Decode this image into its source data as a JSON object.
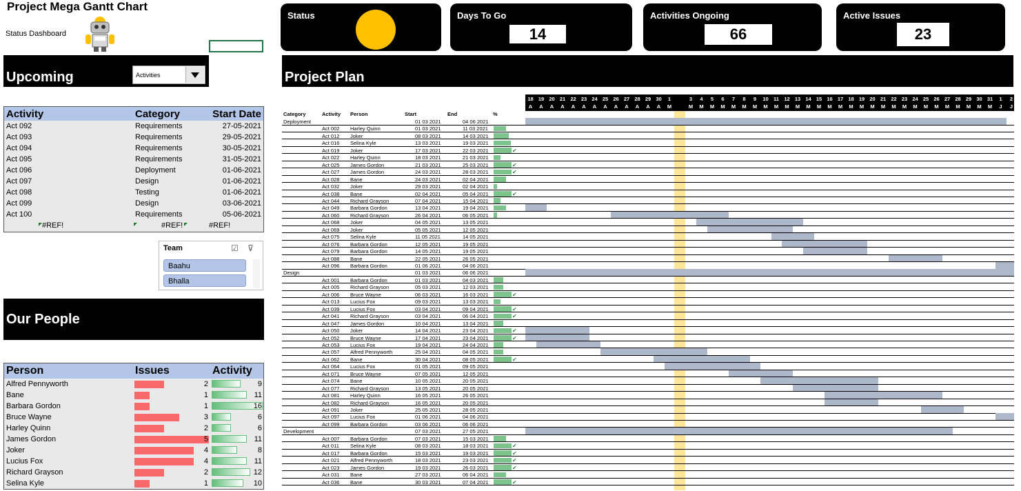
{
  "title": "Project Mega Gantt Chart",
  "subtitle": "Status Dashboard",
  "upcoming": {
    "heading": "Upcoming",
    "dropdown": "Activities",
    "columns": [
      "Activity",
      "Category",
      "Start Date"
    ],
    "rows": [
      [
        "Act 092",
        "Requirements",
        "27-05-2021"
      ],
      [
        "Act 093",
        "Requirements",
        "29-05-2021"
      ],
      [
        "Act 094",
        "Requirements",
        "30-05-2021"
      ],
      [
        "Act 095",
        "Requirements",
        "31-05-2021"
      ],
      [
        "Act 096",
        "Deployment",
        "01-06-2021"
      ],
      [
        "Act 097",
        "Design",
        "01-06-2021"
      ],
      [
        "Act 098",
        "Testing",
        "01-06-2021"
      ],
      [
        "Act 099",
        "Design",
        "03-06-2021"
      ],
      [
        "Act 100",
        "Requirements",
        "05-06-2021"
      ],
      [
        "#REF!",
        "#REF!",
        "#REF!"
      ]
    ]
  },
  "slicer": {
    "title": "Team",
    "items": [
      "Baahu",
      "Bhalla"
    ]
  },
  "people": {
    "heading": "Our People",
    "columns": [
      "Person",
      "Issues",
      "Activity"
    ],
    "rows": [
      {
        "name": "Alfred Pennyworth",
        "issues": 2,
        "activity": 9
      },
      {
        "name": "Bane",
        "issues": 1,
        "activity": 11
      },
      {
        "name": "Barbara Gordon",
        "issues": 1,
        "activity": 16
      },
      {
        "name": "Bruce Wayne",
        "issues": 3,
        "activity": 6
      },
      {
        "name": "Harley Quinn",
        "issues": 2,
        "activity": 6
      },
      {
        "name": "James Gordon",
        "issues": 5,
        "activity": 11
      },
      {
        "name": "Joker",
        "issues": 4,
        "activity": 8
      },
      {
        "name": "Lucius Fox",
        "issues": 4,
        "activity": 11
      },
      {
        "name": "Richard Grayson",
        "issues": 2,
        "activity": 12
      },
      {
        "name": "Selina Kyle",
        "issues": 1,
        "activity": 10
      }
    ]
  },
  "cards": {
    "status": {
      "label": "Status",
      "color": "#ffc000"
    },
    "days": {
      "label": "Days To Go",
      "value": "14"
    },
    "ongoing": {
      "label": "Activities Ongoing",
      "value": "66"
    },
    "issues": {
      "label": "Active Issues",
      "value": "23"
    }
  },
  "plan": {
    "heading": "Project Plan",
    "col_headers": [
      "Category",
      "Activity",
      "Person",
      "Start",
      "End",
      "%"
    ],
    "days": [
      "18",
      "19",
      "20",
      "21",
      "22",
      "23",
      "24",
      "25",
      "26",
      "27",
      "28",
      "29",
      "30",
      "1",
      "",
      "3",
      "4",
      "5",
      "6",
      "7",
      "8",
      "9",
      "10",
      "11",
      "12",
      "13",
      "14",
      "15",
      "16",
      "17",
      "18",
      "19",
      "20",
      "21",
      "22",
      "23",
      "24",
      "25",
      "26",
      "27",
      "28",
      "29",
      "30",
      "31",
      "1",
      "2"
    ],
    "months": [
      "A",
      "A",
      "A",
      "A",
      "A",
      "A",
      "A",
      "A",
      "A",
      "A",
      "A",
      "A",
      "A",
      "M",
      "",
      "M",
      "M",
      "M",
      "M",
      "M",
      "M",
      "M",
      "M",
      "M",
      "M",
      "M",
      "M",
      "M",
      "M",
      "M",
      "M",
      "M",
      "M",
      "M",
      "M",
      "M",
      "M",
      "M",
      "M",
      "M",
      "M",
      "M",
      "M",
      "M",
      "J",
      "J"
    ],
    "rows": [
      {
        "c": "Deployment",
        "a": "",
        "p": "",
        "s": "01 03 2021",
        "e": "04 06 2021",
        "pct": 0,
        "chk": false,
        "bar": [
          0,
          45
        ]
      },
      {
        "c": "",
        "a": "Act 002",
        "p": "Harley Quinn",
        "s": "01 03 2021",
        "e": "11 03 2021",
        "pct": 0.7,
        "chk": false,
        "bar": null
      },
      {
        "c": "",
        "a": "Act 012",
        "p": "Joker",
        "s": "08 03 2021",
        "e": "14 03 2021",
        "pct": 0.85,
        "chk": false,
        "bar": null
      },
      {
        "c": "",
        "a": "Act 016",
        "p": "Selina Kyle",
        "s": "13 03 2021",
        "e": "19 03 2021",
        "pct": 0.95,
        "chk": false,
        "bar": null
      },
      {
        "c": "",
        "a": "Act 019",
        "p": "Joker",
        "s": "17 03 2021",
        "e": "22 03 2021",
        "pct": 1,
        "chk": true,
        "bar": null
      },
      {
        "c": "",
        "a": "Act 022",
        "p": "Harley Quinn",
        "s": "18 03 2021",
        "e": "21 03 2021",
        "pct": 0.4,
        "chk": false,
        "bar": null
      },
      {
        "c": "",
        "a": "Act 025",
        "p": "James Gordon",
        "s": "21 03 2021",
        "e": "25 03 2021",
        "pct": 1,
        "chk": true,
        "bar": null
      },
      {
        "c": "",
        "a": "Act 027",
        "p": "James Gordon",
        "s": "24 03 2021",
        "e": "28 03 2021",
        "pct": 1,
        "chk": true,
        "bar": null
      },
      {
        "c": "",
        "a": "Act 028",
        "p": "Bane",
        "s": "24 03 2021",
        "e": "02 04 2021",
        "pct": 0.7,
        "chk": false,
        "bar": null
      },
      {
        "c": "",
        "a": "Act 032",
        "p": "Joker",
        "s": "29 03 2021",
        "e": "02 04 2021",
        "pct": 0.2,
        "chk": false,
        "bar": null
      },
      {
        "c": "",
        "a": "Act 038",
        "p": "Bane",
        "s": "02 04 2021",
        "e": "05 04 2021",
        "pct": 1,
        "chk": true,
        "bar": null
      },
      {
        "c": "",
        "a": "Act 044",
        "p": "Richard Grayson",
        "s": "07 04 2021",
        "e": "15 04 2021",
        "pct": 0.4,
        "chk": false,
        "bar": null
      },
      {
        "c": "",
        "a": "Act 049",
        "p": "Barbara Gordon",
        "s": "13 04 2021",
        "e": "19 04 2021",
        "pct": 0.7,
        "chk": false,
        "bar": [
          0,
          2
        ]
      },
      {
        "c": "",
        "a": "Act 060",
        "p": "Richard Grayson",
        "s": "26 04 2021",
        "e": "06 05 2021",
        "pct": 0.2,
        "chk": false,
        "bar": [
          8,
          19
        ]
      },
      {
        "c": "",
        "a": "Act 068",
        "p": "Joker",
        "s": "04 05 2021",
        "e": "13 05 2021",
        "pct": 0,
        "chk": false,
        "bar": [
          16,
          26
        ]
      },
      {
        "c": "",
        "a": "Act 069",
        "p": "Joker",
        "s": "05 05 2021",
        "e": "12 05 2021",
        "pct": 0,
        "chk": false,
        "bar": [
          17,
          25
        ]
      },
      {
        "c": "",
        "a": "Act 075",
        "p": "Selina Kyle",
        "s": "11 05 2021",
        "e": "14 05 2021",
        "pct": 0,
        "chk": false,
        "bar": [
          23,
          27
        ]
      },
      {
        "c": "",
        "a": "Act 076",
        "p": "Barbara Gordon",
        "s": "12 05 2021",
        "e": "19 05 2021",
        "pct": 0,
        "chk": false,
        "bar": [
          24,
          32
        ]
      },
      {
        "c": "",
        "a": "Act 079",
        "p": "Barbara Gordon",
        "s": "14 05 2021",
        "e": "19 05 2021",
        "pct": 0,
        "chk": false,
        "bar": [
          26,
          32
        ]
      },
      {
        "c": "",
        "a": "Act 088",
        "p": "Bane",
        "s": "22 05 2021",
        "e": "26 05 2021",
        "pct": 0,
        "chk": false,
        "bar": [
          34,
          39
        ]
      },
      {
        "c": "",
        "a": "Act 096",
        "p": "Barbara Gordon",
        "s": "01 06 2021",
        "e": "04 06 2021",
        "pct": 0,
        "chk": false,
        "bar": [
          44,
          46
        ]
      },
      {
        "c": "Design",
        "a": "",
        "p": "",
        "s": "01 03 2021",
        "e": "06 06 2021",
        "pct": 0,
        "chk": false,
        "bar": [
          0,
          46
        ]
      },
      {
        "c": "",
        "a": "Act 001",
        "p": "Barbara Gordon",
        "s": "01 03 2021",
        "e": "04 03 2021",
        "pct": 0.55,
        "chk": false,
        "bar": null
      },
      {
        "c": "",
        "a": "Act 005",
        "p": "Richard Grayson",
        "s": "05 03 2021",
        "e": "12 03 2021",
        "pct": 0.55,
        "chk": false,
        "bar": null
      },
      {
        "c": "",
        "a": "Act 006",
        "p": "Bruce Wayne",
        "s": "06 03 2021",
        "e": "16 03 2021",
        "pct": 1,
        "chk": true,
        "bar": null
      },
      {
        "c": "",
        "a": "Act 013",
        "p": "Lucius Fox",
        "s": "09 03 2021",
        "e": "13 03 2021",
        "pct": 0.4,
        "chk": false,
        "bar": null
      },
      {
        "c": "",
        "a": "Act 039",
        "p": "Lucius Fox",
        "s": "03 04 2021",
        "e": "09 04 2021",
        "pct": 1,
        "chk": true,
        "bar": null
      },
      {
        "c": "",
        "a": "Act 041",
        "p": "Richard Grayson",
        "s": "03 04 2021",
        "e": "06 04 2021",
        "pct": 1,
        "chk": true,
        "bar": null
      },
      {
        "c": "",
        "a": "Act 047",
        "p": "James Gordon",
        "s": "10 04 2021",
        "e": "13 04 2021",
        "pct": 0.55,
        "chk": false,
        "bar": null
      },
      {
        "c": "",
        "a": "Act 050",
        "p": "Joker",
        "s": "14 04 2021",
        "e": "23 04 2021",
        "pct": 1,
        "chk": true,
        "bar": [
          0,
          6
        ]
      },
      {
        "c": "",
        "a": "Act 052",
        "p": "Bruce Wayne",
        "s": "17 04 2021",
        "e": "23 04 2021",
        "pct": 1,
        "chk": true,
        "bar": [
          0,
          6
        ]
      },
      {
        "c": "",
        "a": "Act 053",
        "p": "Lucius Fox",
        "s": "19 04 2021",
        "e": "24 04 2021",
        "pct": 0.55,
        "chk": false,
        "bar": [
          1,
          7
        ]
      },
      {
        "c": "",
        "a": "Act 057",
        "p": "Alfred Pennyworth",
        "s": "25 04 2021",
        "e": "04 05 2021",
        "pct": 0.55,
        "chk": false,
        "bar": [
          7,
          17
        ]
      },
      {
        "c": "",
        "a": "Act 062",
        "p": "Bane",
        "s": "30 04 2021",
        "e": "08 05 2021",
        "pct": 1,
        "chk": true,
        "bar": [
          12,
          21
        ]
      },
      {
        "c": "",
        "a": "Act 064",
        "p": "Lucius Fox",
        "s": "01 05 2021",
        "e": "09 05 2021",
        "pct": 0,
        "chk": false,
        "bar": [
          13,
          22
        ]
      },
      {
        "c": "",
        "a": "Act 071",
        "p": "Bruce Wayne",
        "s": "07 05 2021",
        "e": "12 05 2021",
        "pct": 0,
        "chk": false,
        "bar": [
          19,
          25
        ]
      },
      {
        "c": "",
        "a": "Act 074",
        "p": "Bane",
        "s": "10 05 2021",
        "e": "20 05 2021",
        "pct": 0,
        "chk": false,
        "bar": [
          22,
          33
        ]
      },
      {
        "c": "",
        "a": "Act 077",
        "p": "Richard Grayson",
        "s": "13 05 2021",
        "e": "20 05 2021",
        "pct": 0,
        "chk": false,
        "bar": [
          25,
          33
        ]
      },
      {
        "c": "",
        "a": "Act 081",
        "p": "Harley Quinn",
        "s": "16 05 2021",
        "e": "26 05 2021",
        "pct": 0,
        "chk": false,
        "bar": [
          28,
          39
        ]
      },
      {
        "c": "",
        "a": "Act 082",
        "p": "Richard Grayson",
        "s": "16 05 2021",
        "e": "20 05 2021",
        "pct": 0,
        "chk": false,
        "bar": [
          28,
          33
        ]
      },
      {
        "c": "",
        "a": "Act 091",
        "p": "Joker",
        "s": "25 05 2021",
        "e": "28 05 2021",
        "pct": 0,
        "chk": false,
        "bar": [
          37,
          41
        ]
      },
      {
        "c": "",
        "a": "Act 097",
        "p": "Lucius Fox",
        "s": "01 06 2021",
        "e": "04 06 2021",
        "pct": 0,
        "chk": false,
        "bar": [
          44,
          46
        ]
      },
      {
        "c": "",
        "a": "Act 099",
        "p": "Barbara Gordon",
        "s": "03 06 2021",
        "e": "06 06 2021",
        "pct": 0,
        "chk": false,
        "bar": null
      },
      {
        "c": "Development",
        "a": "",
        "p": "",
        "s": "07 03 2021",
        "e": "27 05 2021",
        "pct": 0,
        "chk": false,
        "bar": [
          0,
          40
        ]
      },
      {
        "c": "",
        "a": "Act 007",
        "p": "Barbara Gordon",
        "s": "07 03 2021",
        "e": "15 03 2021",
        "pct": 0.7,
        "chk": false,
        "bar": null
      },
      {
        "c": "",
        "a": "Act 011",
        "p": "Selina Kyle",
        "s": "08 03 2021",
        "e": "18 03 2021",
        "pct": 1,
        "chk": true,
        "bar": null
      },
      {
        "c": "",
        "a": "Act 017",
        "p": "Barbara Gordon",
        "s": "15 03 2021",
        "e": "19 03 2021",
        "pct": 1,
        "chk": true,
        "bar": null
      },
      {
        "c": "",
        "a": "Act 021",
        "p": "Alfred Pennyworth",
        "s": "18 03 2021",
        "e": "23 03 2021",
        "pct": 1,
        "chk": true,
        "bar": null
      },
      {
        "c": "",
        "a": "Act 023",
        "p": "James Gordon",
        "s": "19 03 2021",
        "e": "26 03 2021",
        "pct": 1,
        "chk": true,
        "bar": null
      },
      {
        "c": "",
        "a": "Act 031",
        "p": "Bane",
        "s": "27 03 2021",
        "e": "06 04 2021",
        "pct": 0.7,
        "chk": false,
        "bar": null
      },
      {
        "c": "",
        "a": "Act 036",
        "p": "Bane",
        "s": "30 03 2021",
        "e": "07 04 2021",
        "pct": 1,
        "chk": true,
        "bar": null
      }
    ]
  }
}
